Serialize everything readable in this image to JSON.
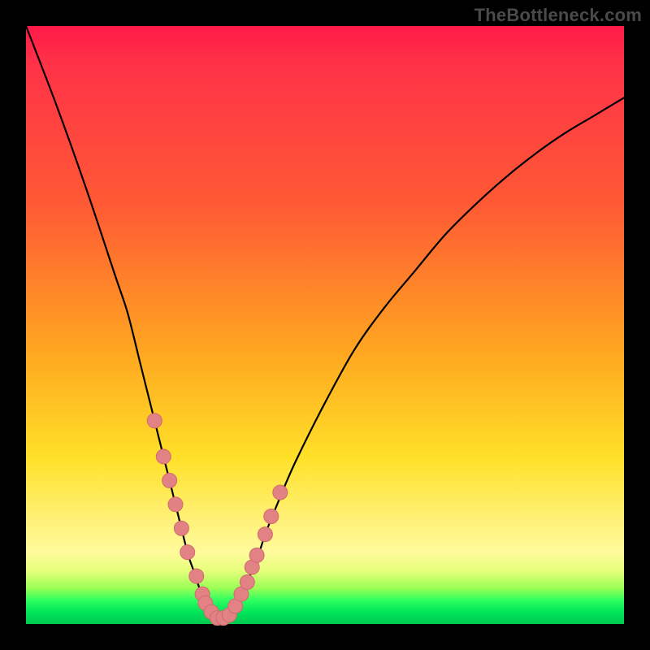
{
  "watermark": "TheBottleneck.com",
  "colors": {
    "curve_stroke": "#000000",
    "marker_fill": "#e28284",
    "marker_stroke": "#d06a6d"
  },
  "chart_data": {
    "type": "line",
    "title": "",
    "xlabel": "",
    "ylabel": "",
    "xlim": [
      0,
      100
    ],
    "ylim": [
      0,
      100
    ],
    "x": [
      0,
      5,
      10,
      15,
      17,
      19,
      20,
      21,
      23,
      25,
      27,
      28,
      29,
      30,
      31,
      32,
      33,
      34,
      35,
      37,
      39,
      40,
      42,
      45,
      50,
      55,
      60,
      65,
      70,
      75,
      80,
      85,
      90,
      95,
      100
    ],
    "values": [
      100,
      87,
      73,
      58,
      52,
      44,
      40,
      36,
      28,
      20,
      12,
      9,
      6,
      3.5,
      2,
      1,
      1,
      1.5,
      3,
      7,
      12,
      15,
      20,
      27,
      37,
      46,
      53,
      59,
      65,
      70,
      74.5,
      78.5,
      82,
      85,
      88
    ],
    "markers": {
      "x": [
        21.5,
        23,
        24,
        25,
        26,
        27,
        28.5,
        29.5,
        30,
        31,
        32,
        33,
        34,
        35,
        36,
        37,
        37.8,
        38.6,
        40,
        41,
        42.5
      ],
      "y": [
        34,
        28,
        24,
        20,
        16,
        12,
        8,
        5,
        3.5,
        2,
        1,
        1,
        1.5,
        3,
        5,
        7,
        9.5,
        11.5,
        15,
        18,
        22
      ]
    }
  }
}
